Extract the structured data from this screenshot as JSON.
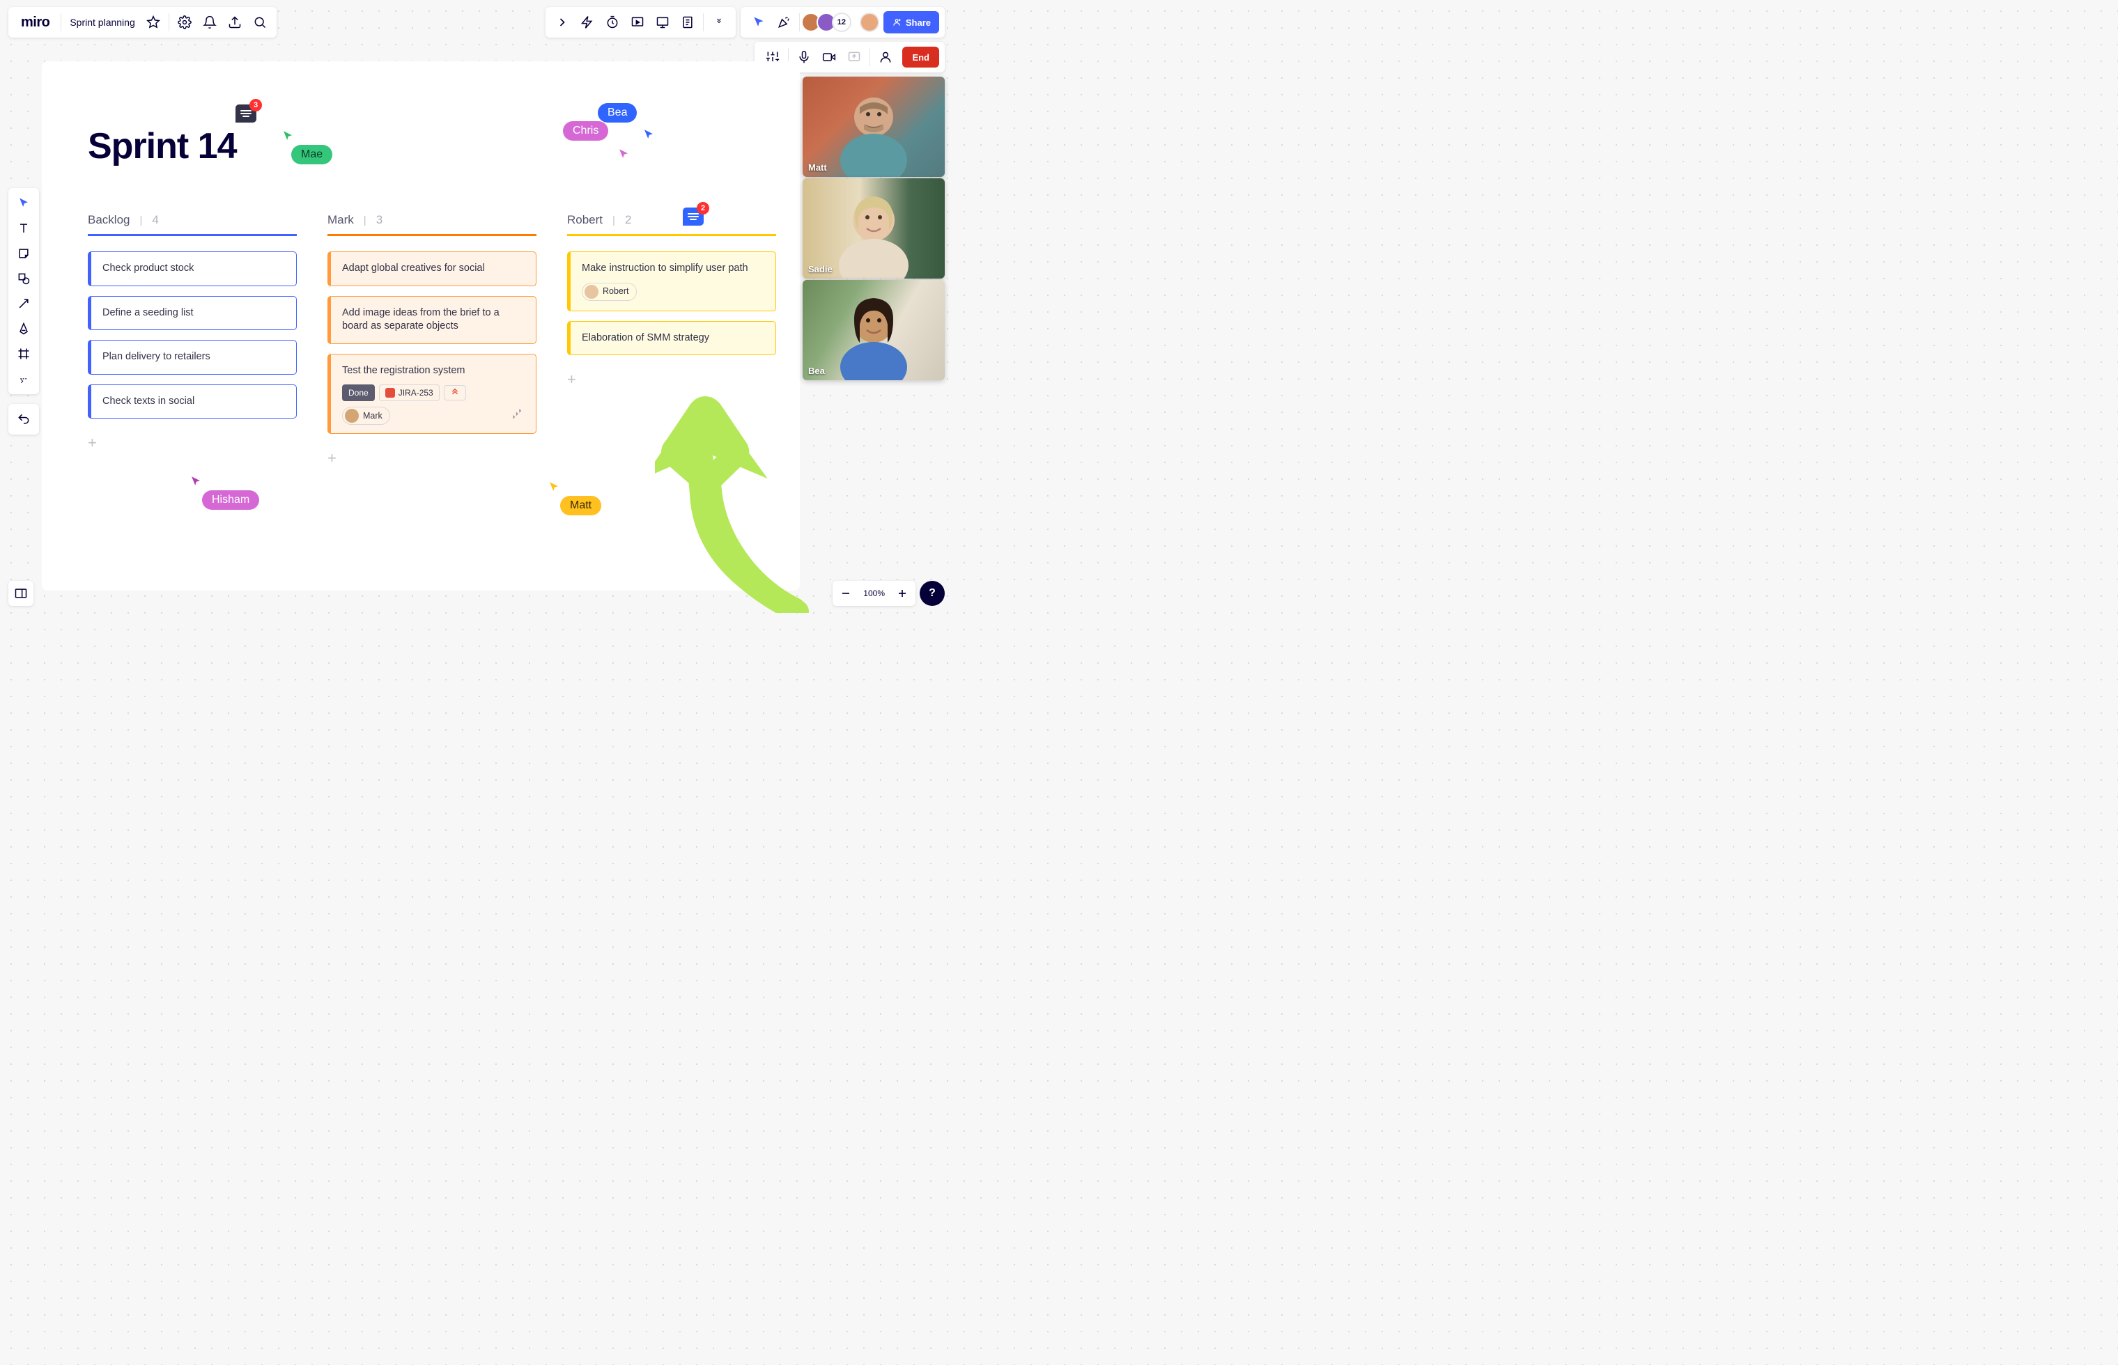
{
  "logo": "miro",
  "board_name": "Sprint planning",
  "share_label": "Share",
  "end_label": "End",
  "avatar_overflow": "12",
  "zoom_level": "100%",
  "help": "?",
  "board_title": "Sprint 14",
  "comment_badges": {
    "top": "3",
    "robert": "2"
  },
  "cursors": {
    "mae": "Mae",
    "bea": "Bea",
    "chris": "Chris",
    "hisham": "Hisham",
    "matt": "Matt"
  },
  "videos": {
    "0": {
      "name": "Matt"
    },
    "1": {
      "name": "Sadie"
    },
    "2": {
      "name": "Bea"
    }
  },
  "columns": {
    "backlog": {
      "name": "Backlog",
      "count": "4",
      "cards": {
        "0": "Check product stock",
        "1": "Define a seeding list",
        "2": "Plan delivery to retailers",
        "3": "Check texts in social"
      }
    },
    "mark": {
      "name": "Mark",
      "count": "3",
      "cards": {
        "0": "Adapt global creatives for social",
        "1": "Add image ideas from the brief to a board as separate objects",
        "2": {
          "title": "Test the registration system",
          "status": "Done",
          "jira": "JIRA-253",
          "assignee": "Mark"
        }
      }
    },
    "robert": {
      "name": "Robert",
      "count": "2",
      "cards": {
        "0": {
          "title": "Make instruction to simplify user path",
          "assignee": "Robert"
        },
        "1": "Elaboration of SMM strategy"
      }
    }
  },
  "colors": {
    "blue": "#4262ff",
    "orange": "#ff7a00",
    "yellow": "#ffc800",
    "green_cursor": "#2bbf6a",
    "pink": "#d668d6",
    "bea_blue": "#3064ff",
    "matt_yellow": "#ffc020"
  }
}
